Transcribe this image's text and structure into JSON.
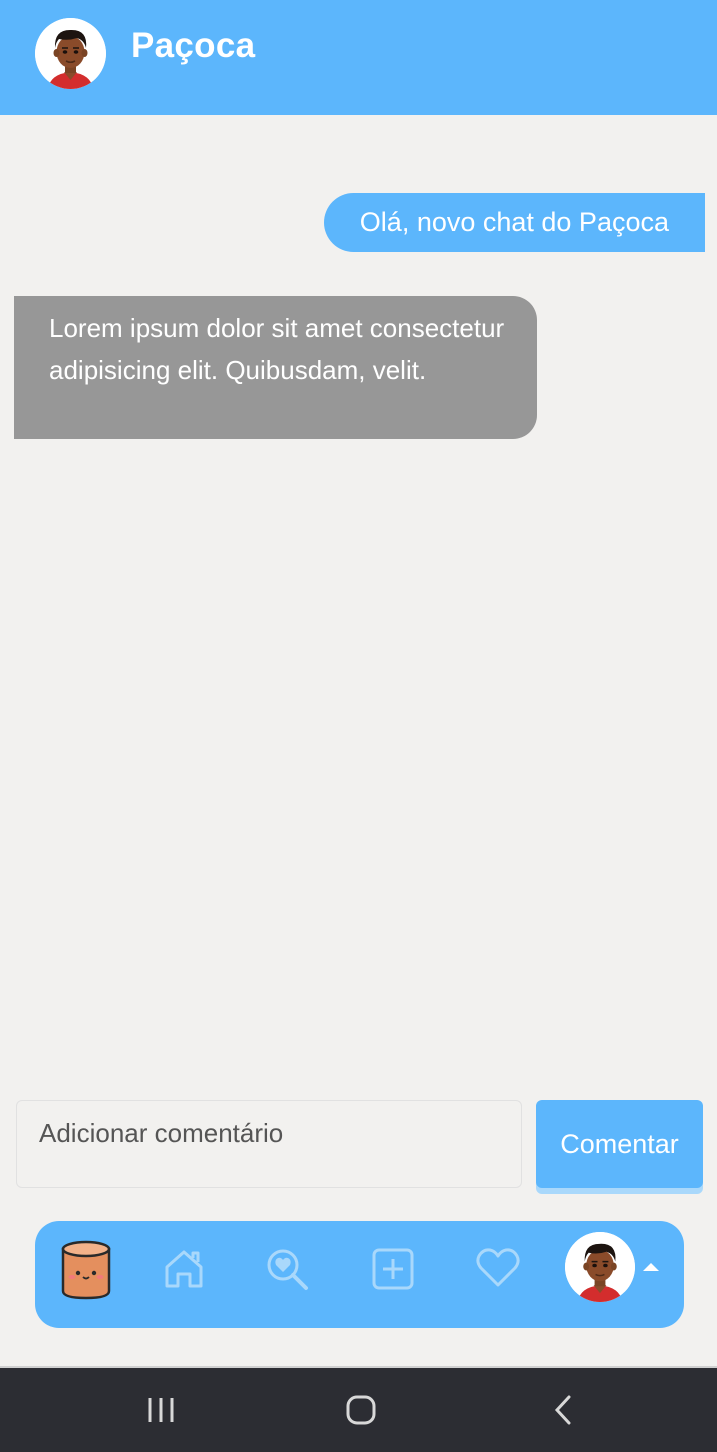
{
  "header": {
    "title": "Paçoca",
    "avatar_icon": "user-avatar-icon"
  },
  "messages": [
    {
      "direction": "sent",
      "text": "Olá, novo chat do Paçoca"
    },
    {
      "direction": "received",
      "text": "Lorem ipsum dolor sit amet consectetur adipisicing elit. Quibusdam, velit."
    }
  ],
  "composer": {
    "placeholder": "Adicionar comentário",
    "value": "",
    "submit_label": "Comentar"
  },
  "bottom_nav": {
    "items": [
      {
        "id": "logo",
        "icon": "pacoca-logo-icon"
      },
      {
        "id": "home",
        "icon": "home-icon"
      },
      {
        "id": "search",
        "icon": "search-heart-icon"
      },
      {
        "id": "create",
        "icon": "add-post-icon"
      },
      {
        "id": "likes",
        "icon": "heart-icon"
      },
      {
        "id": "profile",
        "icon": "user-avatar-icon"
      }
    ]
  },
  "system_nav": {
    "buttons": [
      "recent-apps-icon",
      "home-circle-icon",
      "back-icon"
    ]
  },
  "colors": {
    "primary": "#5cb6fc",
    "received_bubble": "#979797",
    "background": "#f2f1ef",
    "system_bar": "#2c2d33"
  }
}
